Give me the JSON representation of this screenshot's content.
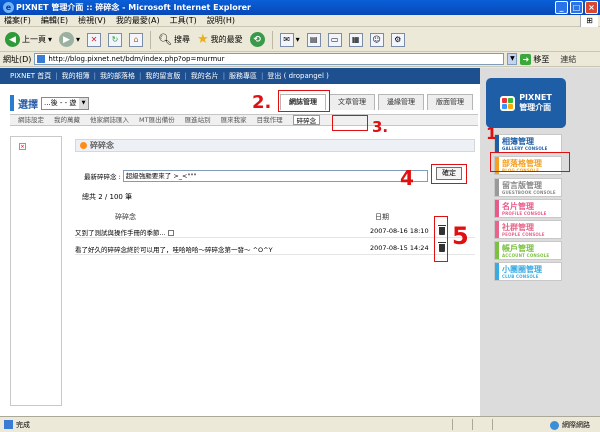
{
  "window": {
    "title": "PIXNET 管理介面 :: 碎碎念 - Microsoft Internet Explorer",
    "buttons": [
      "_",
      "□",
      "×"
    ]
  },
  "menubar": {
    "items": [
      "檔案(F)",
      "編輯(E)",
      "檢視(V)",
      "我的最愛(A)",
      "工具(T)",
      "說明(H)"
    ]
  },
  "toolbar": {
    "back_label": "上一頁",
    "search_label": "搜尋",
    "favorites_label": "我的最愛"
  },
  "addressbar": {
    "label": "網址(D)",
    "url": "http://blog.pixnet.net/bdm/index.php?op=murmur",
    "go_label": "移至",
    "links_label": "連結"
  },
  "topnav": {
    "items": [
      "PIXNET 首頁",
      "我的相簿",
      "我的部落格",
      "我的留言版",
      "我的名片",
      "服務專區",
      "登出 ( dropangel )"
    ]
  },
  "selector": {
    "label": "選擇",
    "value": "...後 - - 遊 ..."
  },
  "tabs": {
    "items": [
      "網誌管理",
      "文章管理",
      "邊緣管理",
      "版面管理"
    ]
  },
  "subnav": {
    "items": [
      "網誌設定",
      "我的萬藏",
      "他家網誌匯入",
      "MT匯出備份",
      "匯進站別",
      "匯來我家",
      "目我作理",
      "碎碎念"
    ]
  },
  "section": {
    "title": "碎碎念"
  },
  "murmur_form": {
    "label": "最新碎碎念 :",
    "value": "超級強颱要來了 >_<\"\"\"",
    "submit_label": "確定"
  },
  "total_text": "總共 2 / 100 筆",
  "table": {
    "headers": [
      "碎碎念",
      "日期"
    ],
    "rows": [
      {
        "message": "又到了測試與操作手冊的季節...",
        "date": "2007-08-16 18:10"
      },
      {
        "message": "看了好久的碎碎念終於可以用了，哇哈哈哈～碎碎念第一發～ ^O^Y",
        "date": "2007-08-15 14:24"
      }
    ]
  },
  "side_panel": {
    "logo_line1": "PIXNET",
    "logo_line2": "管理介面",
    "consoles": [
      {
        "title": "相簿管理",
        "subtitle": "GALLERY CONSOLE",
        "color": "#1e5ea6"
      },
      {
        "title": "部落格管理",
        "subtitle": "BLOG CONSOLE",
        "color": "#f5a020"
      },
      {
        "title": "留言版管理",
        "subtitle": "GUESTBOOK CONSOLE",
        "color": "#9a9a9a"
      },
      {
        "title": "名片管理",
        "subtitle": "PROFILE CONSOLE",
        "color": "#e85a8a"
      },
      {
        "title": "社群管理",
        "subtitle": "PEOPLE CONSOLE",
        "color": "#e8648a"
      },
      {
        "title": "帳戶管理",
        "subtitle": "ACCOUNT CONSOLE",
        "color": "#7bc040"
      },
      {
        "title": "小團圈管理",
        "subtitle": "CLUB CONSOLE",
        "color": "#3aaae0"
      }
    ]
  },
  "annotations": [
    "1",
    "2.",
    "3.",
    "4",
    "5"
  ],
  "statusbar": {
    "status": "完成",
    "zone": "網際網路"
  }
}
